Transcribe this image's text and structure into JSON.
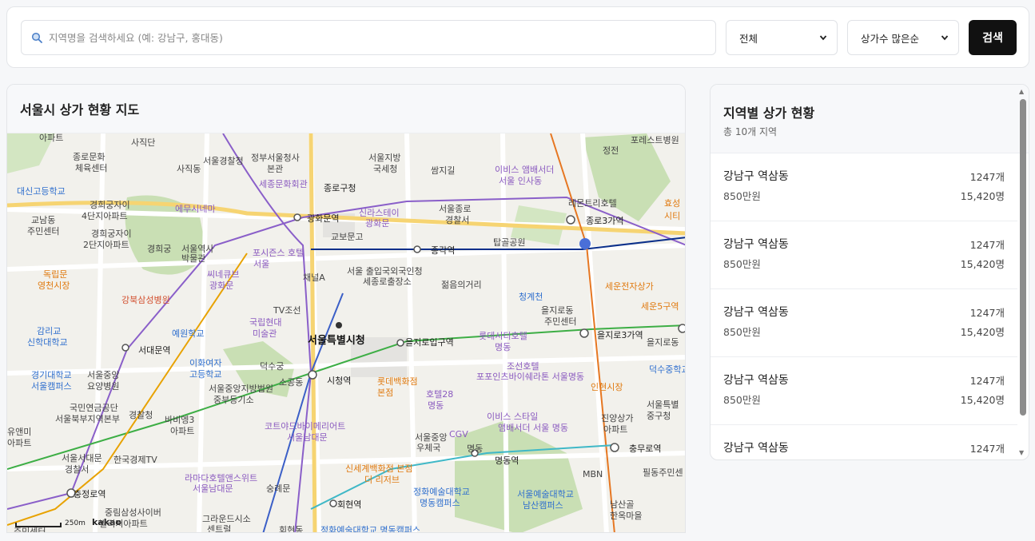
{
  "search": {
    "placeholder": "지역명을 검색하세요 (예: 강남구, 홍대동)",
    "region_value": "전체",
    "sort_value": "상가수 많은순",
    "button_label": "검색"
  },
  "map": {
    "title": "서울시 상가 현황 지도",
    "scale_label": "250m",
    "logo": "kakao",
    "labels": [
      {
        "text": "아파트",
        "cls": ""
      },
      {
        "text": "사직단",
        "cls": ""
      },
      {
        "text": "종로문화",
        "cls": ""
      },
      {
        "text": "체육센터",
        "cls": ""
      },
      {
        "text": "서울경찰청",
        "cls": ""
      },
      {
        "text": "정부서울청사",
        "cls": ""
      },
      {
        "text": "본관",
        "cls": ""
      },
      {
        "text": "서울지방",
        "cls": ""
      },
      {
        "text": "국세청",
        "cls": ""
      },
      {
        "text": "쌈지길",
        "cls": ""
      },
      {
        "text": "이비스 앰배서더",
        "cls": "lbl-purple"
      },
      {
        "text": "서울 인사동",
        "cls": "lbl-purple"
      },
      {
        "text": "포레스트병원",
        "cls": ""
      },
      {
        "text": "정전",
        "cls": ""
      },
      {
        "text": "사직동",
        "cls": ""
      },
      {
        "text": "대신고등학교",
        "cls": "lbl-blue"
      },
      {
        "text": "경희궁자이",
        "cls": ""
      },
      {
        "text": "4단지아파트",
        "cls": ""
      },
      {
        "text": "에무시네마",
        "cls": "lbl-purple"
      },
      {
        "text": "세종문화회관",
        "cls": "lbl-purple"
      },
      {
        "text": "종로구청",
        "cls": "lbl-dark"
      },
      {
        "text": "신라스테이",
        "cls": "lbl-purple"
      },
      {
        "text": "광화문",
        "cls": "lbl-purple"
      },
      {
        "text": "서울종로",
        "cls": ""
      },
      {
        "text": "경찰서",
        "cls": ""
      },
      {
        "text": "레몬트리호텔",
        "cls": ""
      },
      {
        "text": "효성",
        "cls": "lbl-orange"
      },
      {
        "text": "시티",
        "cls": "lbl-orange"
      },
      {
        "text": "교남동",
        "cls": ""
      },
      {
        "text": "주민센터",
        "cls": ""
      },
      {
        "text": "경희궁자이",
        "cls": ""
      },
      {
        "text": "2단지아파트",
        "cls": ""
      },
      {
        "text": "광화문역",
        "cls": "lbl-dark"
      },
      {
        "text": "교보문고",
        "cls": ""
      },
      {
        "text": "종각역",
        "cls": "lbl-dark"
      },
      {
        "text": "탑골공원",
        "cls": ""
      },
      {
        "text": "종로3가역",
        "cls": "lbl-dark"
      },
      {
        "text": "독립문",
        "cls": "lbl-orange"
      },
      {
        "text": "영천시장",
        "cls": "lbl-orange"
      },
      {
        "text": "경희궁",
        "cls": ""
      },
      {
        "text": "서울역사",
        "cls": ""
      },
      {
        "text": "박물관",
        "cls": ""
      },
      {
        "text": "포시즌스 호텔",
        "cls": "lbl-purple"
      },
      {
        "text": "서울",
        "cls": "lbl-purple"
      },
      {
        "text": "서울 출입국외국인청",
        "cls": ""
      },
      {
        "text": "세종로출장소",
        "cls": ""
      },
      {
        "text": "씨네큐브",
        "cls": "lbl-purple"
      },
      {
        "text": "광화문",
        "cls": "lbl-purple"
      },
      {
        "text": "채널A",
        "cls": ""
      },
      {
        "text": "젊음의거리",
        "cls": ""
      },
      {
        "text": "세운전자상가",
        "cls": "lbl-orange"
      },
      {
        "text": "강북삼성병원",
        "cls": "lbl-red"
      },
      {
        "text": "청계천",
        "cls": "lbl-blue"
      },
      {
        "text": "세운5구역",
        "cls": "lbl-orange"
      },
      {
        "text": "TV조선",
        "cls": ""
      },
      {
        "text": "을지로동",
        "cls": ""
      },
      {
        "text": "주민센터",
        "cls": ""
      },
      {
        "text": "감리교",
        "cls": "lbl-blue"
      },
      {
        "text": "신학대학교",
        "cls": "lbl-blue"
      },
      {
        "text": "예원학교",
        "cls": "lbl-blue"
      },
      {
        "text": "국립현대",
        "cls": "lbl-purple"
      },
      {
        "text": "미술관",
        "cls": "lbl-purple"
      },
      {
        "text": "서울특별시청",
        "cls": "lbl-big"
      },
      {
        "text": "을지로입구역",
        "cls": "lbl-dark"
      },
      {
        "text": "롯데시티호텔",
        "cls": "lbl-purple"
      },
      {
        "text": "명동",
        "cls": "lbl-purple"
      },
      {
        "text": "을지로3가역",
        "cls": "lbl-dark"
      },
      {
        "text": "을지로동",
        "cls": ""
      },
      {
        "text": "서대문역",
        "cls": "lbl-dark"
      },
      {
        "text": "이화여자",
        "cls": "lbl-blue"
      },
      {
        "text": "고등학교",
        "cls": "lbl-blue"
      },
      {
        "text": "덕수궁",
        "cls": ""
      },
      {
        "text": "조선호텔",
        "cls": "lbl-purple"
      },
      {
        "text": "덕수중학교",
        "cls": "lbl-blue"
      },
      {
        "text": "경기대학교",
        "cls": "lbl-blue"
      },
      {
        "text": "서울캠퍼스",
        "cls": "lbl-blue"
      },
      {
        "text": "서울중앙",
        "cls": ""
      },
      {
        "text": "요양병원",
        "cls": ""
      },
      {
        "text": "소공동",
        "cls": ""
      },
      {
        "text": "시청역",
        "cls": "lbl-dark"
      },
      {
        "text": "롯데백화점",
        "cls": "lbl-orange"
      },
      {
        "text": "본점",
        "cls": "lbl-orange"
      },
      {
        "text": "포포인츠바이쉐라톤 서울명동",
        "cls": "lbl-purple"
      },
      {
        "text": "인현시장",
        "cls": "lbl-orange"
      },
      {
        "text": "서울특별",
        "cls": ""
      },
      {
        "text": "중구청",
        "cls": ""
      },
      {
        "text": "서울중앙지방법원",
        "cls": ""
      },
      {
        "text": "중부등기소",
        "cls": ""
      },
      {
        "text": "호텔28",
        "cls": "lbl-purple"
      },
      {
        "text": "명동",
        "cls": "lbl-purple"
      },
      {
        "text": "국민연금공단",
        "cls": ""
      },
      {
        "text": "서울북부지역본부",
        "cls": ""
      },
      {
        "text": "경찰청",
        "cls": ""
      },
      {
        "text": "바비엥3",
        "cls": ""
      },
      {
        "text": "아파트",
        "cls": ""
      },
      {
        "text": "이비스 스타일",
        "cls": "lbl-purple"
      },
      {
        "text": "앰배서더 서울 명동",
        "cls": "lbl-purple"
      },
      {
        "text": "진양상가",
        "cls": ""
      },
      {
        "text": "아파트",
        "cls": ""
      },
      {
        "text": "유앤미",
        "cls": ""
      },
      {
        "text": "아파트",
        "cls": ""
      },
      {
        "text": "코트야드바이메리어트",
        "cls": "lbl-purple"
      },
      {
        "text": "서울남대문",
        "cls": "lbl-purple"
      },
      {
        "text": "서울중앙",
        "cls": ""
      },
      {
        "text": "우체국",
        "cls": ""
      },
      {
        "text": "CGV",
        "cls": "lbl-purple"
      },
      {
        "text": "명동",
        "cls": ""
      },
      {
        "text": "충무로역",
        "cls": "lbl-dark"
      },
      {
        "text": "서울서대문",
        "cls": ""
      },
      {
        "text": "경찰서",
        "cls": ""
      },
      {
        "text": "한국경제TV",
        "cls": ""
      },
      {
        "text": "명동역",
        "cls": "lbl-dark"
      },
      {
        "text": "필동주민센",
        "cls": ""
      },
      {
        "text": "신세계백화점 본점",
        "cls": "lbl-orange"
      },
      {
        "text": "더 리저브",
        "cls": "lbl-orange"
      },
      {
        "text": "MBN",
        "cls": ""
      },
      {
        "text": "충정로역",
        "cls": "lbl-dark"
      },
      {
        "text": "라마다호텔앤스위트",
        "cls": "lbl-purple"
      },
      {
        "text": "서울남대문",
        "cls": "lbl-purple"
      },
      {
        "text": "숭례문",
        "cls": ""
      },
      {
        "text": "정화예술대학교",
        "cls": "lbl-blue"
      },
      {
        "text": "명동캠퍼스",
        "cls": "lbl-blue"
      },
      {
        "text": "서울예술대학교",
        "cls": "lbl-blue"
      },
      {
        "text": "남산캠퍼스",
        "cls": "lbl-blue"
      },
      {
        "text": "남산골",
        "cls": ""
      },
      {
        "text": "한옥마을",
        "cls": ""
      },
      {
        "text": "중림삼성사이버",
        "cls": ""
      },
      {
        "text": "빌리지아파트",
        "cls": ""
      },
      {
        "text": "회현역",
        "cls": "lbl-dark"
      },
      {
        "text": "그라운드시소",
        "cls": ""
      },
      {
        "text": "센트럴",
        "cls": ""
      },
      {
        "text": "회현동",
        "cls": ""
      },
      {
        "text": "정화예술대학교 명동캠퍼스",
        "cls": "lbl-blue"
      },
      {
        "text": "주민센터",
        "cls": ""
      }
    ]
  },
  "list": {
    "title": "지역별 상가 현황",
    "subtitle": "총 10개 지역",
    "items": [
      {
        "name": "강남구 역삼동",
        "count": "1247개",
        "price": "850만원",
        "population": "15,420명"
      },
      {
        "name": "강남구 역삼동",
        "count": "1247개",
        "price": "850만원",
        "population": "15,420명"
      },
      {
        "name": "강남구 역삼동",
        "count": "1247개",
        "price": "850만원",
        "population": "15,420명"
      },
      {
        "name": "강남구 역삼동",
        "count": "1247개",
        "price": "850만원",
        "population": "15,420명"
      },
      {
        "name": "강남구 역삼동",
        "count": "1247개",
        "price": "",
        "population": ""
      }
    ]
  }
}
